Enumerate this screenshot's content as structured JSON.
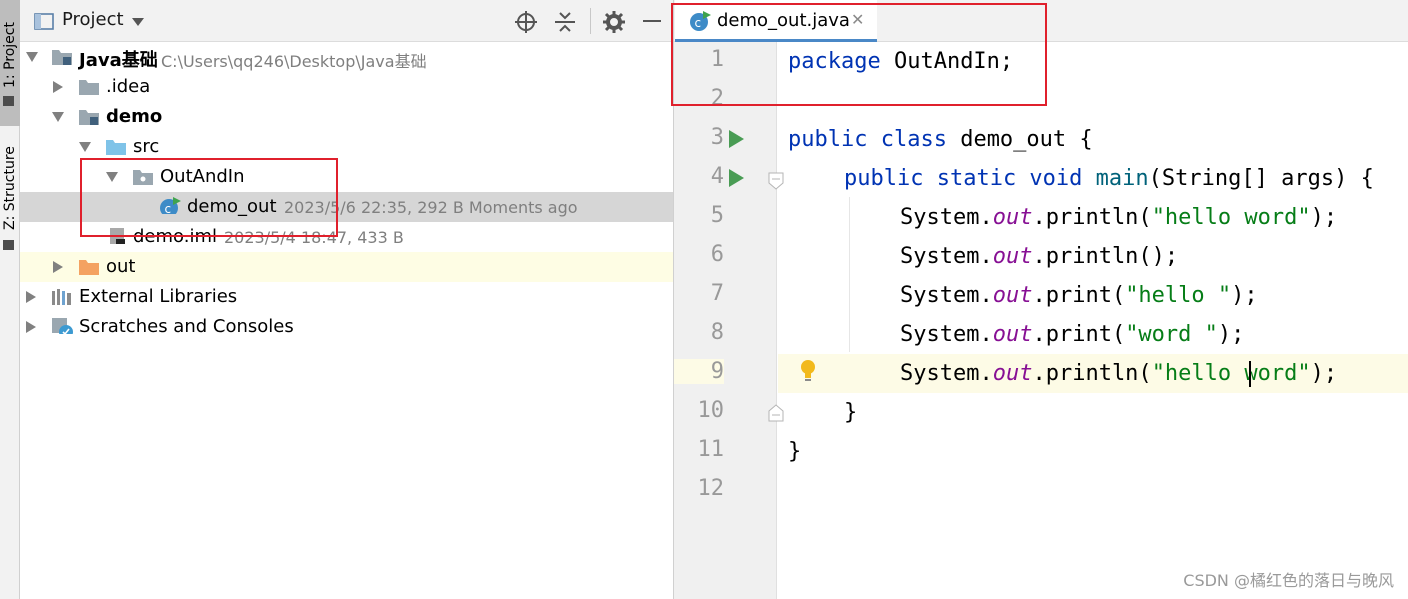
{
  "sidebar": {
    "project_tab": "1: Project",
    "structure_tab": "Z: Structure"
  },
  "project_panel": {
    "title": "Project",
    "tree": [
      {
        "label": "Java基础",
        "meta": "C:\\Users\\qq246\\Desktop\\Java基础",
        "bold": true
      },
      {
        "label": ".idea",
        "meta": ""
      },
      {
        "label": "demo",
        "meta": "",
        "bold": true
      },
      {
        "label": "src",
        "meta": ""
      },
      {
        "label": "OutAndIn",
        "meta": ""
      },
      {
        "label": "demo_out",
        "meta": "2023/5/6 22:35, 292 B Moments ago"
      },
      {
        "label": "demo.iml",
        "meta": "2023/5/4 18:47, 433 B"
      },
      {
        "label": "out",
        "meta": ""
      },
      {
        "label": "External Libraries",
        "meta": ""
      },
      {
        "label": "Scratches and Consoles",
        "meta": ""
      }
    ]
  },
  "editor": {
    "tab_label": "demo_out.java",
    "line_numbers": [
      "1",
      "2",
      "3",
      "4",
      "5",
      "6",
      "7",
      "8",
      "9",
      "10",
      "11",
      "12"
    ],
    "code": {
      "l1_kw": "package",
      "l1_rest": " OutAndIn;",
      "l3_kw": "public class",
      "l3_rest": " demo_out {",
      "l4_kw": "public static void",
      "l4_mth": "main",
      "l4_rest": "(String[] args) {",
      "sys": "System.",
      "out": "out",
      "l5_call": ".println(",
      "l5_str": "\"hello word\"",
      "l6_call": ".println();",
      "l7_call": ".print(",
      "l7_str": "\"hello \"",
      "l8_call": ".print(",
      "l8_str": "\"word \"",
      "l9_call": ".println(",
      "l9_str": "\"hello word\"",
      "close_paren": ");",
      "l10": "}",
      "l11": "}"
    }
  },
  "watermark": "CSDN @橘红色的落日与晚风",
  "colors": {
    "keyword": "#0033b3",
    "field": "#871094",
    "string": "#067d17",
    "run_icon": "#499c54",
    "highlight_box": "#e0202c"
  }
}
